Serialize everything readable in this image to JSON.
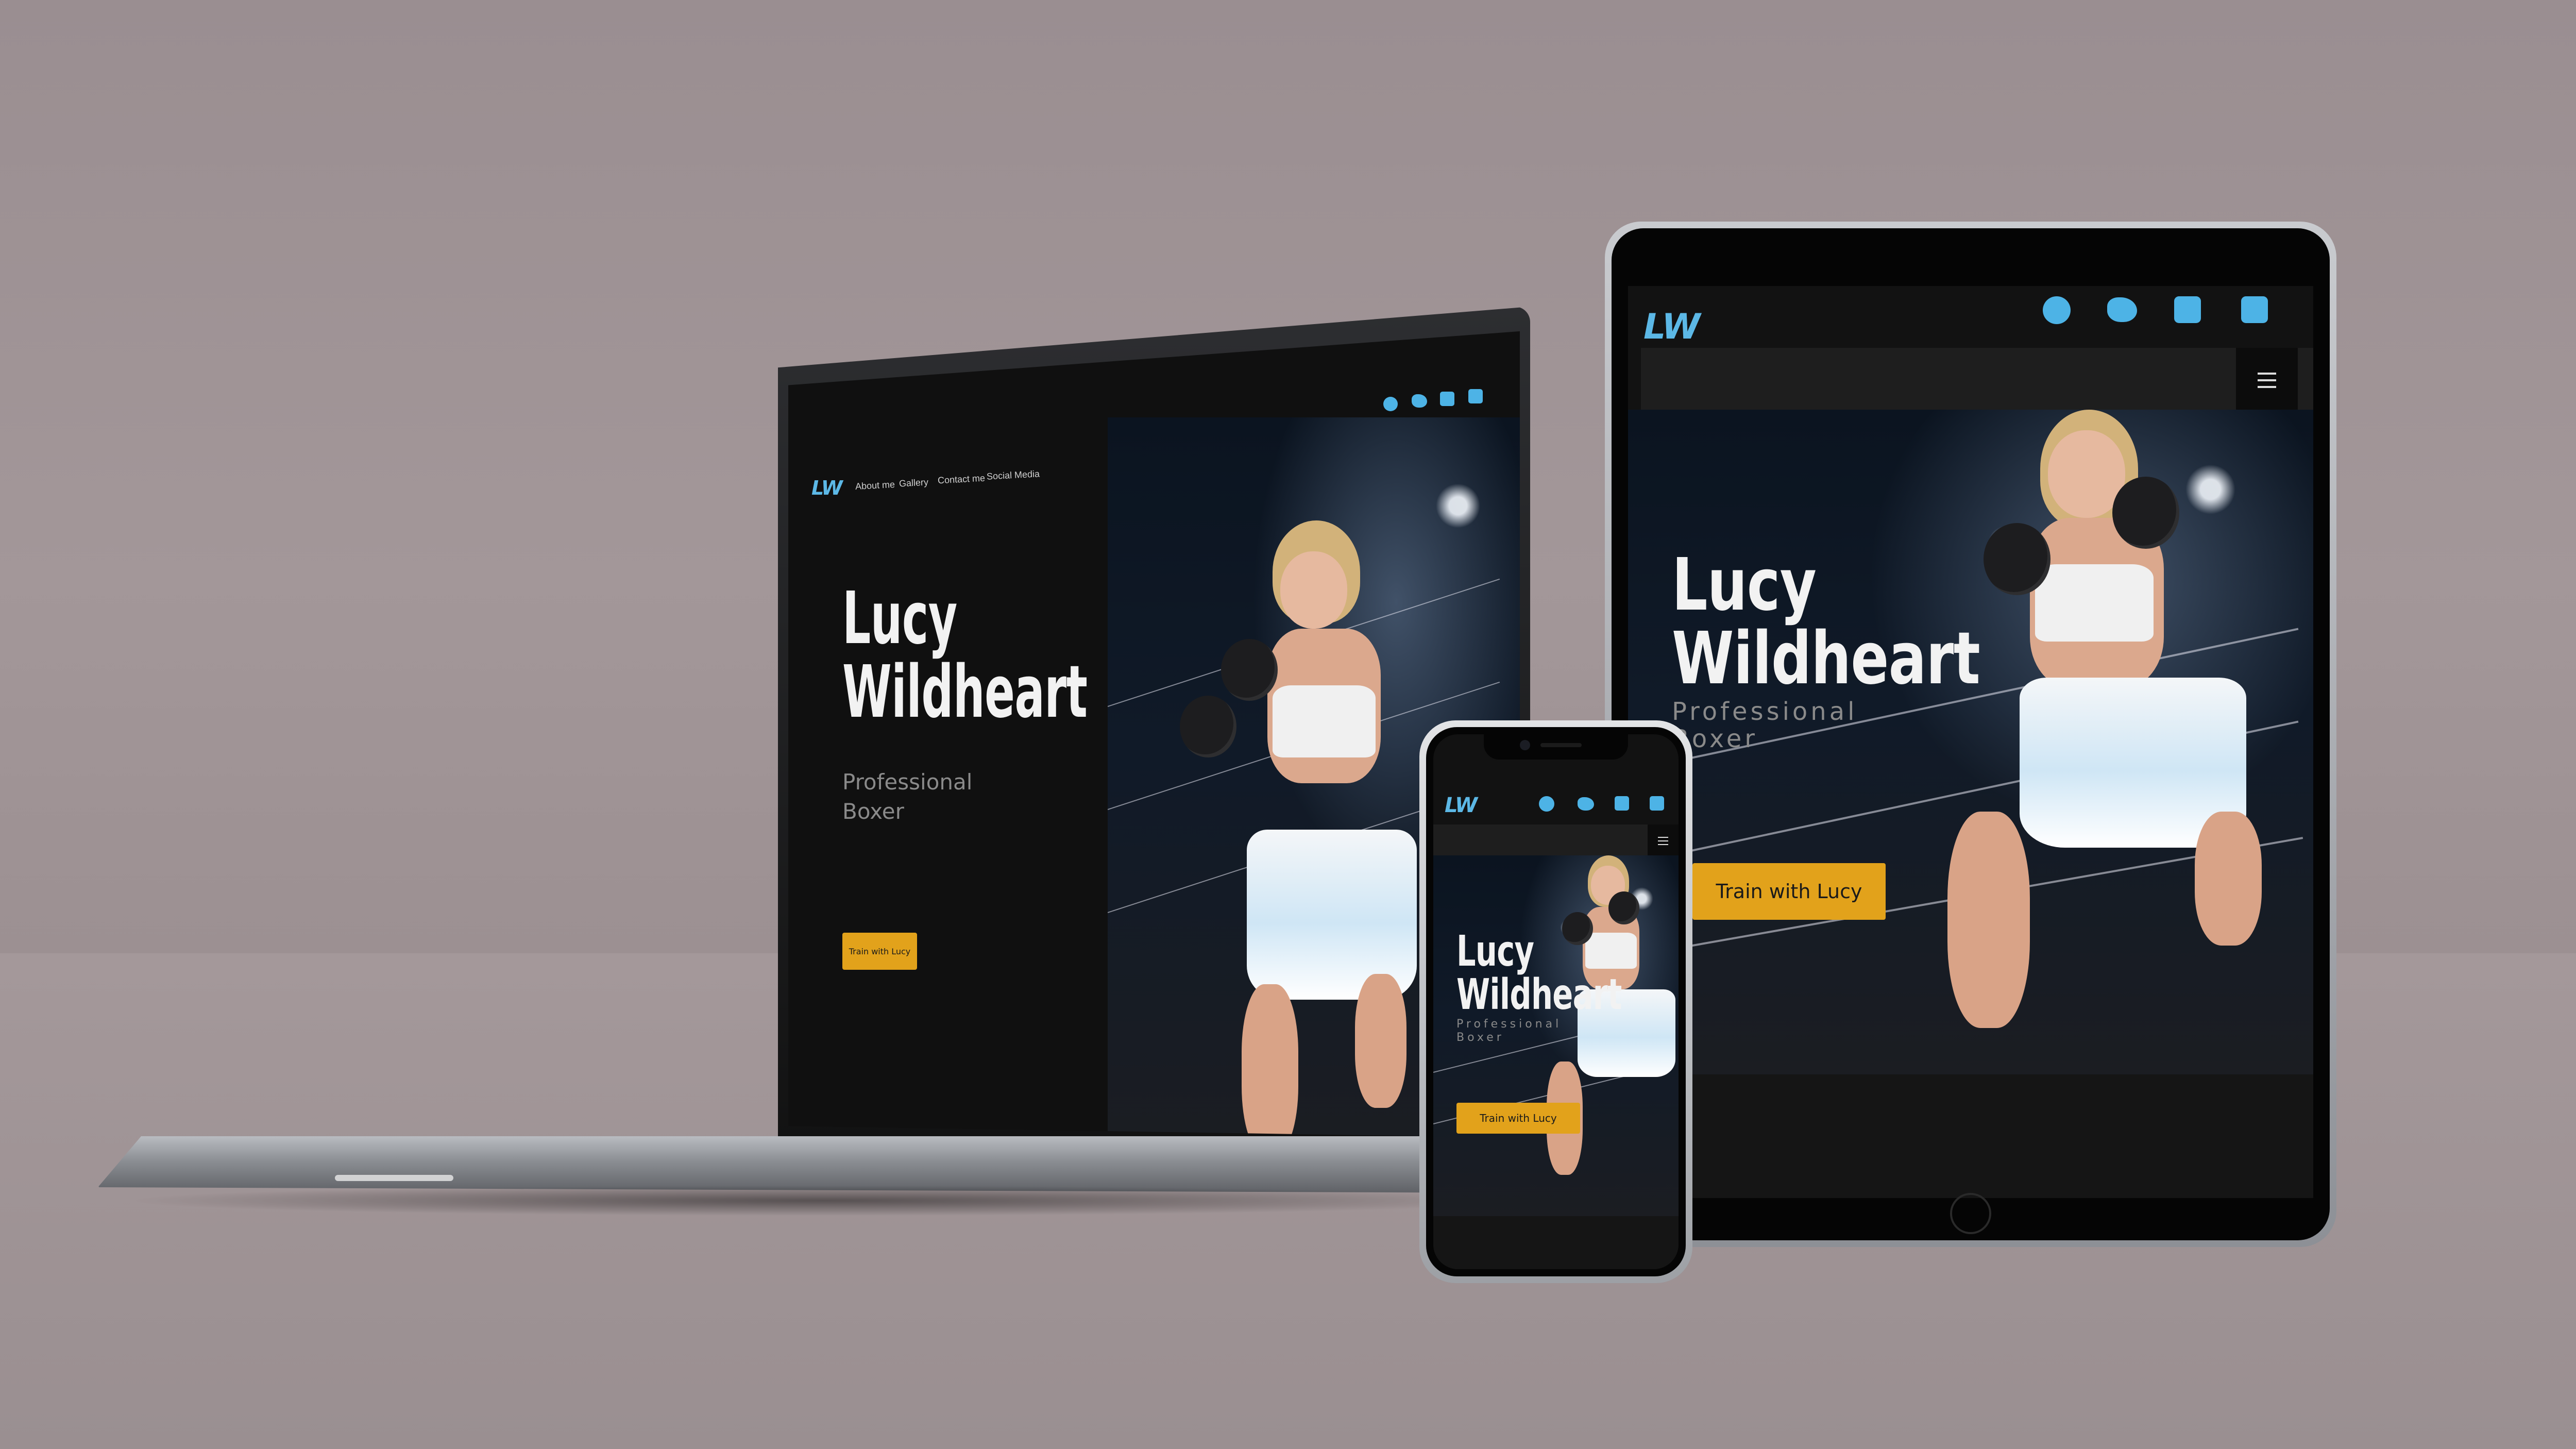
{
  "brand": {
    "logo_text": "LW",
    "accent": "#4db3e6",
    "cta_color": "#e2a21b"
  },
  "nav": {
    "items": [
      "About me",
      "Gallery",
      "Contact me",
      "Social Media"
    ]
  },
  "social": {
    "icons": [
      "facebook-icon",
      "twitter-icon",
      "instagram-icon",
      "linkedin-icon"
    ]
  },
  "hero": {
    "name_line1": "Lucy",
    "name_line2": "Wildheart",
    "subtitle_line1": "Professional",
    "subtitle_line2": "Boxer",
    "cta_label": "Train with Lucy"
  }
}
